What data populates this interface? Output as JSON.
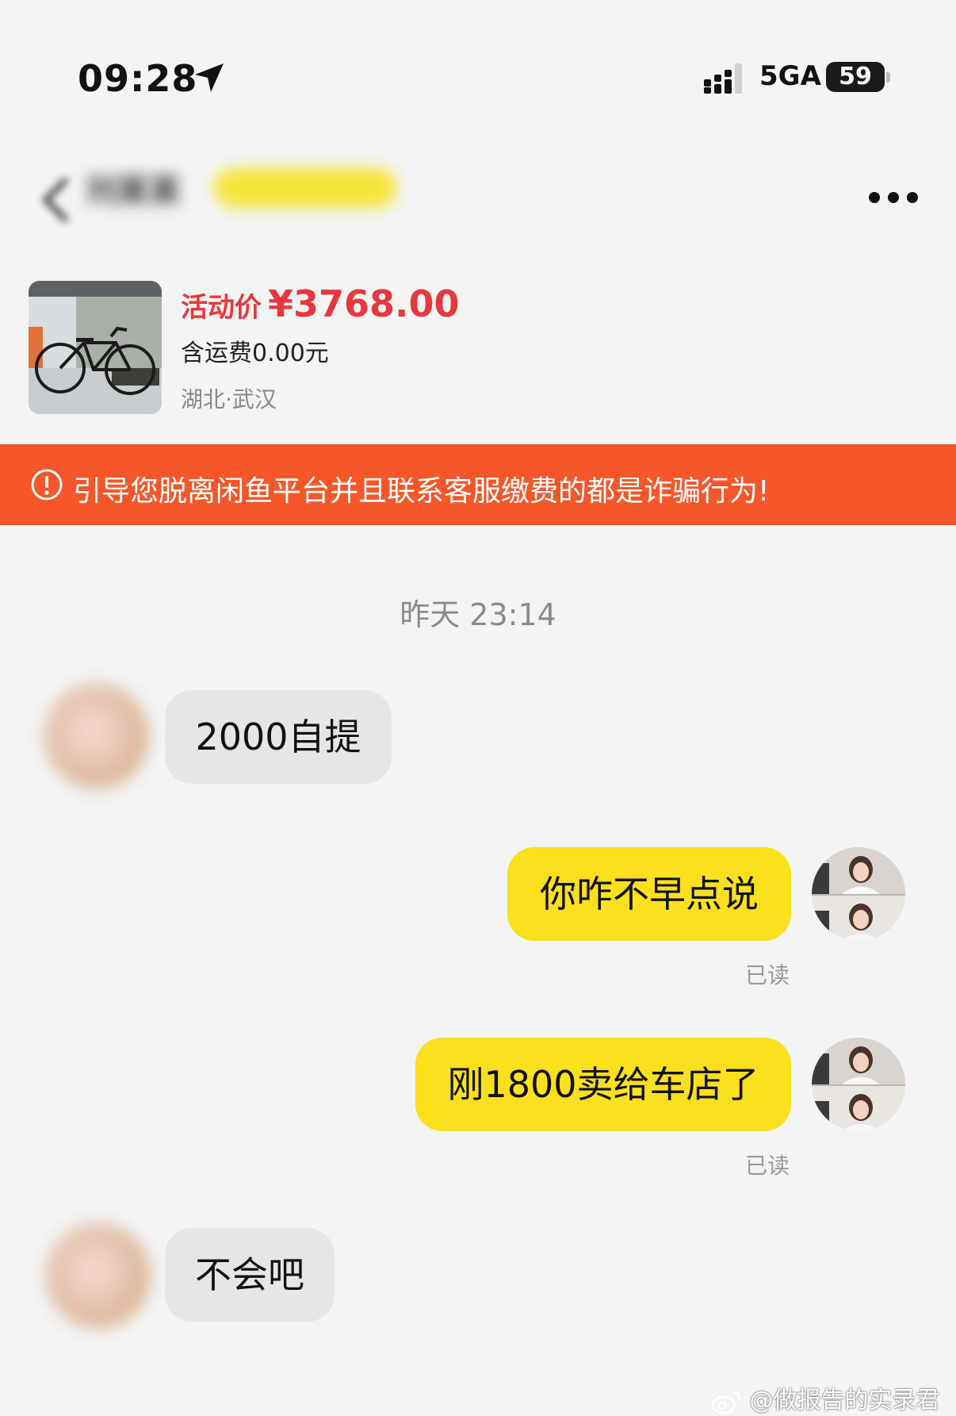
{
  "status_bar": {
    "time": "09:28",
    "network": "5GA",
    "battery": "59"
  },
  "header": {
    "seller_name": "刘某某",
    "seller_badge": "",
    "seller_subtitle": ""
  },
  "product": {
    "price_label": "活动价",
    "price": "¥3768.00",
    "shipping": "含运费0.00元",
    "location": "湖北·武汉"
  },
  "warning": {
    "text": "引导您脱离闲鱼平台并且联系客服缴费的都是诈骗行为!"
  },
  "chat": {
    "timestamp": "昨天 23:14",
    "messages": [
      {
        "side": "left",
        "text": "2000自提"
      },
      {
        "side": "right",
        "text": "你咋不早点说",
        "status": "已读"
      },
      {
        "side": "right",
        "text": "刚1800卖给车店了",
        "status": "已读"
      },
      {
        "side": "left",
        "text": "不会吧"
      }
    ]
  },
  "watermark": {
    "text": "@做报告的实录君"
  },
  "colors": {
    "accent_yellow": "#fae01d",
    "warning_orange": "#f5572b",
    "price_red": "#e8383d"
  },
  "icons": [
    "location-arrow-icon",
    "signal-icon",
    "battery-icon",
    "back-icon",
    "more-icon",
    "warning-icon",
    "weibo-icon"
  ]
}
